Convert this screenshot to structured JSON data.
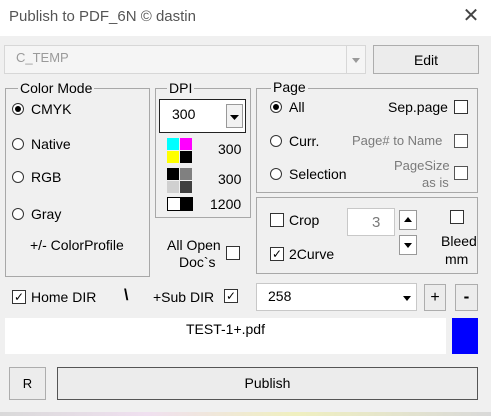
{
  "window": {
    "title": "Publish to PDF_6N © dastin",
    "close_glyph": "✕"
  },
  "path": {
    "value": "C_TEMP",
    "edit_label": "Edit"
  },
  "color_mode": {
    "legend": "Color Mode",
    "options": [
      "CMYK",
      "Native",
      "RGB",
      "Gray"
    ],
    "selected": "CMYK",
    "profile_label": "+/- ColorProfile"
  },
  "dpi": {
    "legend": "DPI",
    "value": "300",
    "rows": [
      "300",
      "300",
      "1200"
    ]
  },
  "all_open_docs": {
    "label_line1": "All Open",
    "label_line2": "Doc`s",
    "checked": false
  },
  "page": {
    "legend": "Page",
    "options": [
      "All",
      "Curr.",
      "Selection"
    ],
    "selected": "All",
    "sep_page": "Sep.page",
    "page_to_name": "Page# to Name",
    "pagesize_line1": "PageSize",
    "pagesize_line2": "as is"
  },
  "crop": {
    "label": "Crop",
    "checked": false,
    "value": "3"
  },
  "two_curve": {
    "label": "2Curve",
    "checked": true
  },
  "bleed": {
    "label_line1": "Bleed",
    "label_line2": "mm",
    "checked": false
  },
  "home_dir": {
    "label": "Home DIR",
    "checked": true,
    "separator": "\\"
  },
  "sub_dir": {
    "label": "+Sub DIR",
    "checked": true
  },
  "counter": {
    "value": "258",
    "plus": "+",
    "minus": "-"
  },
  "filename": {
    "value": "TEST-1+.pdf",
    "indicator_color": "#0000ff"
  },
  "actions": {
    "r_label": "R",
    "publish_label": "Publish"
  }
}
